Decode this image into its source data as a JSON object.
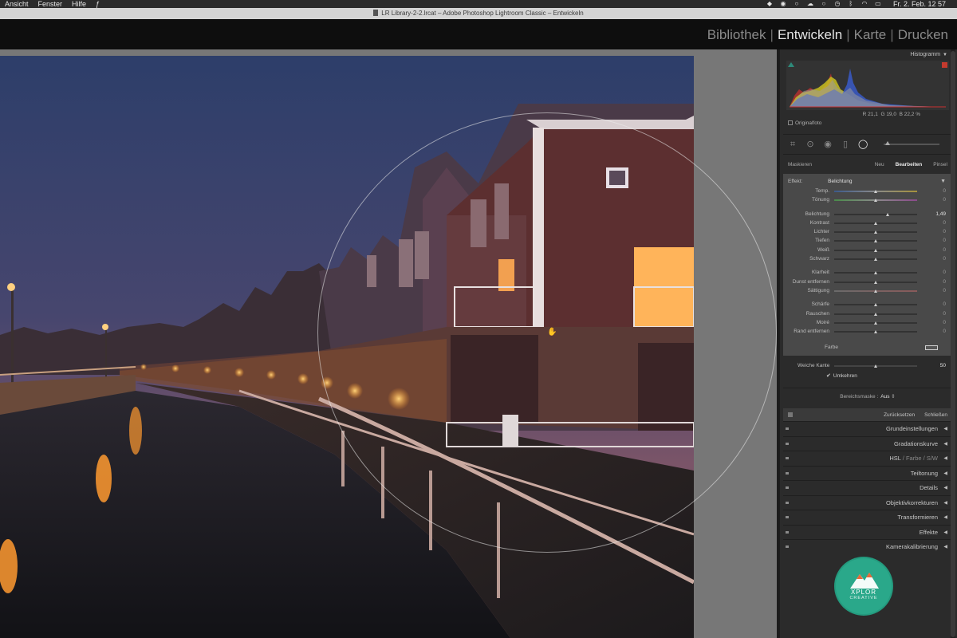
{
  "menubar": {
    "items": [
      "Ansicht",
      "Fenster",
      "Hilfe"
    ],
    "clock": "Fr. 2. Feb. 12 57"
  },
  "window": {
    "title": "LR Library-2-2.lrcat – Adobe Photoshop Lightroom Classic – Entwickeln"
  },
  "modules": {
    "items": [
      "Bibliothek",
      "Entwickeln",
      "Karte",
      "Drucken"
    ],
    "active": "Entwickeln"
  },
  "histogram": {
    "title": "Histogramm",
    "r_label": "R",
    "r_value": "21,1",
    "g_label": "G",
    "g_value": "19,0",
    "b_label": "B",
    "b_value": "22,2",
    "unit": "%",
    "original_photo": "Originalfoto"
  },
  "masking": {
    "label": "Maskieren",
    "new": "Neu",
    "edit": "Bearbeiten",
    "brush": "Pinsel"
  },
  "effect": {
    "label": "Effekt:",
    "value": "Belichtung"
  },
  "sliders": [
    {
      "label": "Temp.",
      "value": "0",
      "pos": 0.5,
      "style": "temp"
    },
    {
      "label": "Tönung",
      "value": "0",
      "pos": 0.5,
      "style": "tint"
    },
    {
      "gap": true
    },
    {
      "label": "Belichtung",
      "value": "1,49",
      "pos": 0.65,
      "highlight": true
    },
    {
      "label": "Kontrast",
      "value": "0",
      "pos": 0.5
    },
    {
      "label": "Lichter",
      "value": "0",
      "pos": 0.5
    },
    {
      "label": "Tiefen",
      "value": "0",
      "pos": 0.5
    },
    {
      "label": "Weiß",
      "value": "0",
      "pos": 0.5
    },
    {
      "label": "Schwarz",
      "value": "0",
      "pos": 0.5
    },
    {
      "gap": true
    },
    {
      "label": "Klarheit",
      "value": "0",
      "pos": 0.5
    },
    {
      "label": "Dunst entfernen",
      "value": "0",
      "pos": 0.5
    },
    {
      "label": "Sättigung",
      "value": "0",
      "pos": 0.5,
      "style": "sat"
    },
    {
      "gap": true
    },
    {
      "label": "Schärfe",
      "value": "0",
      "pos": 0.5
    },
    {
      "label": "Rauschen",
      "value": "0",
      "pos": 0.5
    },
    {
      "label": "Moiré",
      "value": "0",
      "pos": 0.5
    },
    {
      "label": "Rand entfernen",
      "value": "0",
      "pos": 0.5
    }
  ],
  "color": {
    "label": "Farbe"
  },
  "feather": {
    "label": "Weiche Kante",
    "value": "50",
    "pos": 0.5
  },
  "invert": {
    "label": "Umkehren",
    "checked": true
  },
  "range_mask": {
    "label": "Bereichsmaske :",
    "value": "Aus"
  },
  "actions": {
    "reset": "Zurücksetzen",
    "close": "Schließen"
  },
  "sections": [
    "Grundeinstellungen",
    "Gradationskurve",
    "HSL",
    "Teiltonung",
    "Details",
    "Objektivkorrekturen",
    "Transformieren",
    "Effekte",
    "Kamerakalibrierung"
  ],
  "hsl_extra": {
    "sep1": "/",
    "farbe": "Farbe",
    "sep2": "/",
    "sw": "S/W"
  },
  "logo": {
    "line1": "XPLOR",
    "line2": "CREATIVE"
  },
  "colors": {
    "panel_bg": "#2b2b2b",
    "adjust_bg": "#494949",
    "workarea_bg": "#777777",
    "module_bar": "#0e0e0e",
    "logo_green": "#2aa88a"
  }
}
